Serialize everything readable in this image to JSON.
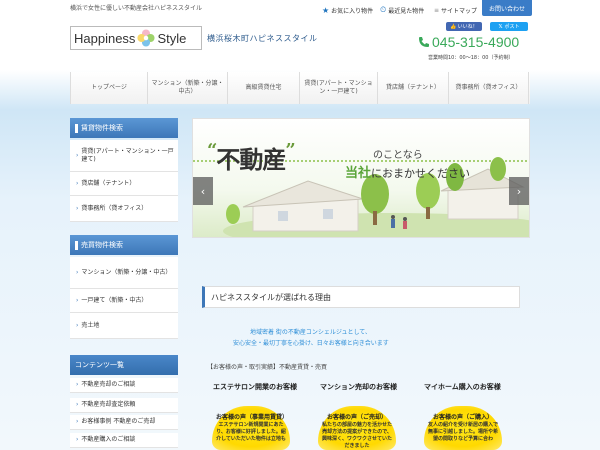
{
  "header": {
    "tagline": "横浜で女性に優しい不動産会社ハピネススタイル",
    "favorites": "お気に入り物件",
    "recent": "最近見た物件",
    "sitemap": "サイトマップ",
    "contact": "お問い合わせ",
    "like": "いいね！",
    "post": "ポスト",
    "logo_text_1": "Happiness",
    "logo_text_2": "Style",
    "company": "横浜桜木町ハピネススタイル",
    "phone": "045-315-4900",
    "hours": "営業時間10：00～18：00（予約制）"
  },
  "nav": {
    "items": [
      {
        "label": "トップページ"
      },
      {
        "label": "マンション（新築・分譲・中古）"
      },
      {
        "label": "高級賃貸住宅"
      },
      {
        "label": "賃貸(アパート・マンション・一戸建て)"
      },
      {
        "label": "貸店舗（テナント）"
      },
      {
        "label": "貸事務所（貸オフィス）"
      }
    ]
  },
  "sidebar": {
    "rent_title": "賃貸物件検索",
    "rent_items": [
      {
        "label": "賃貸(アパート・マンション・一戸建て)"
      },
      {
        "label": "貸店舗（テナント）"
      },
      {
        "label": "貸事務所（貸オフィス）"
      }
    ],
    "sale_title": "売買物件検索",
    "sale_items": [
      {
        "label": "マンション（新築・分譲・中古）"
      },
      {
        "label": "一戸建て（新築・中古）"
      },
      {
        "label": "売土地"
      }
    ],
    "content_title": "コンテンツ一覧",
    "content_items": [
      {
        "label": "不動産売却のご相談"
      },
      {
        "label": "不動産売却査定依頼"
      },
      {
        "label": "お客様事例 不動産のご売却"
      },
      {
        "label": "不動産購入のご相談"
      }
    ]
  },
  "slider": {
    "headline": "不動産",
    "sub1": "のことなら",
    "sub2_highlight": "当社",
    "sub2_rest": "におまかせください",
    "prev": "‹",
    "next": "›"
  },
  "main": {
    "reason_title": "ハピネススタイルが選ばれる理由",
    "blue_line_1": "地域密着 街の不動産コンシェルジュとして、",
    "blue_line_2": "安心安全・最切丁寧を心掛け、日々お客様と向き合います",
    "section_label": "【お客様の声・取引実績】不動産賃貸・売買",
    "columns": [
      {
        "title": "エステサロン開業のお客様",
        "voice": "お客様の声（事業用賃貸）",
        "body": "エステサロン新規開業にあたり、お客様に好評しました。紹介していただいた物件は立地も"
      },
      {
        "title": "マンション売却のお客様",
        "voice": "お客様の声（ご売却）",
        "body": "私たちの部屋の魅力を活かせた売却方法の提案ができたので、興味深く、ワクワクさせていただきました"
      },
      {
        "title": "マイホーム購入のお客様",
        "voice": "お客様の声（ご購入）",
        "body": "友人の紹介を受け新居の購入で無事に引越しました。場所や希望の間取りなど予算に合わ"
      }
    ]
  }
}
